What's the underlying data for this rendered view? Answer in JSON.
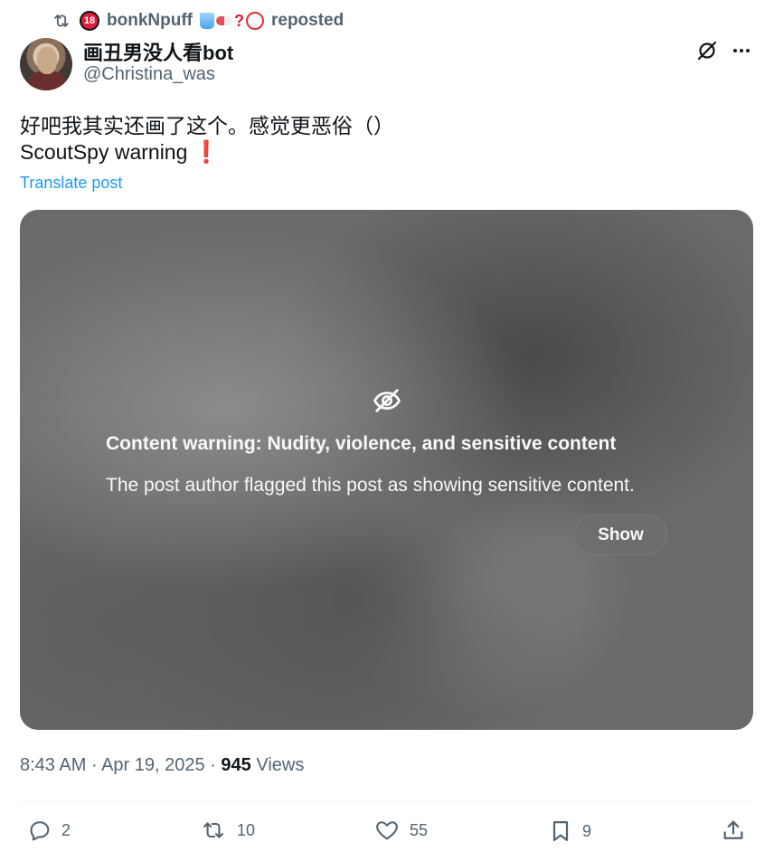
{
  "repost": {
    "user": "bonkNpuff",
    "label": "reposted",
    "badge": "18",
    "question": "?"
  },
  "author": {
    "display_name": "画丑男没人看bot",
    "handle": "@Christina_was"
  },
  "post": {
    "line1": "好吧我其实还画了这个。感觉更恶俗（）",
    "line2": "ScoutSpy warning",
    "emoji": "❗",
    "translate_label": "Translate post"
  },
  "media": {
    "warning_title": "Content warning: Nudity, violence, and sensitive content",
    "warning_body": "The post author flagged this post as showing sensitive content.",
    "show_label": "Show"
  },
  "meta": {
    "time": "8:43 AM",
    "sep1": "·",
    "date": "Apr 19, 2025",
    "sep2": "·",
    "views_count": "945",
    "views_label": "Views"
  },
  "actions": {
    "replies": "2",
    "reposts": "10",
    "likes": "55",
    "bookmarks": "9"
  },
  "colors": {
    "accent": "#1d9bf0",
    "muted": "#536471",
    "text": "#0f1419"
  },
  "icons": [
    "repost-icon",
    "grok-icon",
    "more-icon",
    "eye-off-icon",
    "reply-icon",
    "like-icon",
    "bookmark-icon",
    "share-icon"
  ]
}
